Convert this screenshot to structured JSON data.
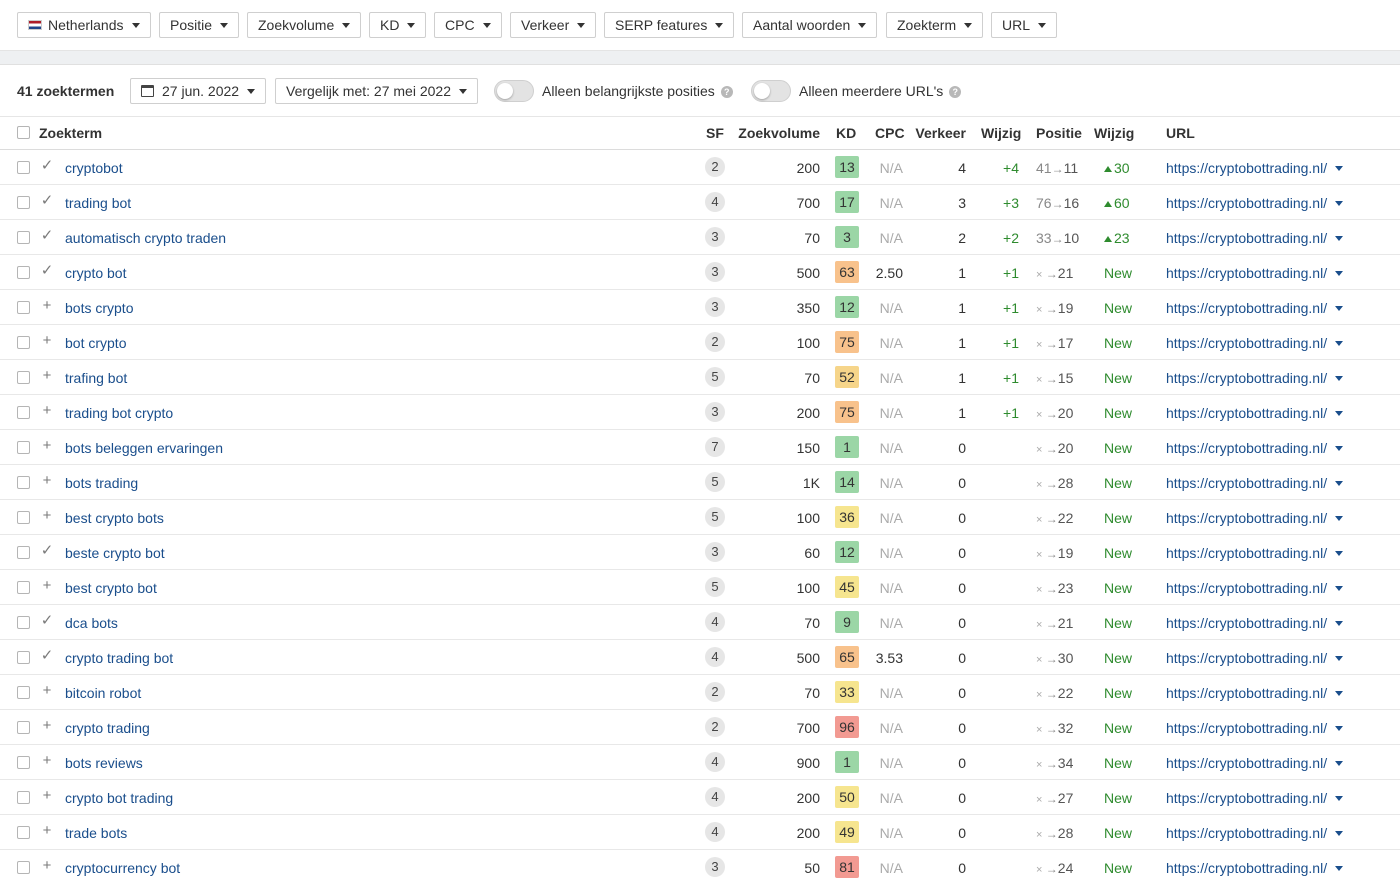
{
  "filters": [
    {
      "label": "Netherlands",
      "flag": true
    },
    {
      "label": "Positie"
    },
    {
      "label": "Zoekvolume"
    },
    {
      "label": "KD"
    },
    {
      "label": "CPC"
    },
    {
      "label": "Verkeer"
    },
    {
      "label": "SERP features"
    },
    {
      "label": "Aantal woorden"
    },
    {
      "label": "Zoekterm"
    },
    {
      "label": "URL"
    }
  ],
  "toolbar": {
    "count": "41 zoektermen",
    "date": "27 jun. 2022",
    "compare": "Vergelijk met: 27 mei 2022",
    "toggle1": "Alleen belangrijkste posities",
    "toggle2": "Alleen meerdere URL's",
    "help": "?"
  },
  "headers": {
    "keyword": "Zoekterm",
    "sf": "SF",
    "volume": "Zoekvolume",
    "kd": "KD",
    "cpc": "CPC",
    "traffic": "Verkeer",
    "change": "Wijzig",
    "position": "Positie",
    "change2": "Wijzig",
    "url": "URL"
  },
  "colors": {
    "kd_green": "#9bd6a6",
    "kd_lightgreen": "#c3e5b5",
    "kd_yellow": "#f6e58f",
    "kd_orange": "#f8c28c",
    "kd_red": "#f29a92",
    "link": "#1a4e8c",
    "positive": "#2e8b2e"
  },
  "rows": [
    {
      "mark": "check",
      "keyword": "cryptobot",
      "sf": "2",
      "volume": "200",
      "kd": "13",
      "kd_color": "#9bd6a6",
      "cpc": "N/A",
      "traffic": "4",
      "change": "+4",
      "pos_old": "41",
      "pos_new": "11",
      "change2": "30",
      "change2_up": true,
      "url": "https://cryptobottrading.nl/"
    },
    {
      "mark": "check",
      "keyword": "trading bot",
      "sf": "4",
      "volume": "700",
      "kd": "17",
      "kd_color": "#9bd6a6",
      "cpc": "N/A",
      "traffic": "3",
      "change": "+3",
      "pos_old": "76",
      "pos_new": "16",
      "change2": "60",
      "change2_up": true,
      "url": "https://cryptobottrading.nl/"
    },
    {
      "mark": "check",
      "keyword": "automatisch crypto traden",
      "sf": "3",
      "volume": "70",
      "kd": "3",
      "kd_color": "#9bd6a6",
      "cpc": "N/A",
      "traffic": "2",
      "change": "+2",
      "pos_old": "33",
      "pos_new": "10",
      "change2": "23",
      "change2_up": true,
      "url": "https://cryptobottrading.nl/"
    },
    {
      "mark": "check",
      "keyword": "crypto bot",
      "sf": "3",
      "volume": "500",
      "kd": "63",
      "kd_color": "#f8c28c",
      "cpc": "2.50",
      "traffic": "1",
      "change": "+1",
      "pos_old": "×",
      "pos_new": "21",
      "change2": "New",
      "change2_up": false,
      "url": "https://cryptobottrading.nl/"
    },
    {
      "mark": "plus",
      "keyword": "bots crypto",
      "sf": "3",
      "volume": "350",
      "kd": "12",
      "kd_color": "#9bd6a6",
      "cpc": "N/A",
      "traffic": "1",
      "change": "+1",
      "pos_old": "×",
      "pos_new": "19",
      "change2": "New",
      "change2_up": false,
      "url": "https://cryptobottrading.nl/"
    },
    {
      "mark": "plus",
      "keyword": "bot crypto",
      "sf": "2",
      "volume": "100",
      "kd": "75",
      "kd_color": "#f8c28c",
      "cpc": "N/A",
      "traffic": "1",
      "change": "+1",
      "pos_old": "×",
      "pos_new": "17",
      "change2": "New",
      "change2_up": false,
      "url": "https://cryptobottrading.nl/"
    },
    {
      "mark": "plus",
      "keyword": "trafing bot",
      "sf": "5",
      "volume": "70",
      "kd": "52",
      "kd_color": "#f6d58a",
      "cpc": "N/A",
      "traffic": "1",
      "change": "+1",
      "pos_old": "×",
      "pos_new": "15",
      "change2": "New",
      "change2_up": false,
      "url": "https://cryptobottrading.nl/"
    },
    {
      "mark": "plus",
      "keyword": "trading bot crypto",
      "sf": "3",
      "volume": "200",
      "kd": "75",
      "kd_color": "#f8c28c",
      "cpc": "N/A",
      "traffic": "1",
      "change": "+1",
      "pos_old": "×",
      "pos_new": "20",
      "change2": "New",
      "change2_up": false,
      "url": "https://cryptobottrading.nl/"
    },
    {
      "mark": "plus",
      "keyword": "bots beleggen ervaringen",
      "sf": "7",
      "volume": "150",
      "kd": "1",
      "kd_color": "#9bd6a6",
      "cpc": "N/A",
      "traffic": "0",
      "change": "",
      "pos_old": "×",
      "pos_new": "20",
      "change2": "New",
      "change2_up": false,
      "url": "https://cryptobottrading.nl/"
    },
    {
      "mark": "plus",
      "keyword": "bots trading",
      "sf": "5",
      "volume": "1K",
      "kd": "14",
      "kd_color": "#9bd6a6",
      "cpc": "N/A",
      "traffic": "0",
      "change": "",
      "pos_old": "×",
      "pos_new": "28",
      "change2": "New",
      "change2_up": false,
      "url": "https://cryptobottrading.nl/"
    },
    {
      "mark": "plus",
      "keyword": "best crypto bots",
      "sf": "5",
      "volume": "100",
      "kd": "36",
      "kd_color": "#f6e58f",
      "cpc": "N/A",
      "traffic": "0",
      "change": "",
      "pos_old": "×",
      "pos_new": "22",
      "change2": "New",
      "change2_up": false,
      "url": "https://cryptobottrading.nl/"
    },
    {
      "mark": "check",
      "keyword": "beste crypto bot",
      "sf": "3",
      "volume": "60",
      "kd": "12",
      "kd_color": "#9bd6a6",
      "cpc": "N/A",
      "traffic": "0",
      "change": "",
      "pos_old": "×",
      "pos_new": "19",
      "change2": "New",
      "change2_up": false,
      "url": "https://cryptobottrading.nl/"
    },
    {
      "mark": "plus",
      "keyword": "best crypto bot",
      "sf": "5",
      "volume": "100",
      "kd": "45",
      "kd_color": "#f6e58f",
      "cpc": "N/A",
      "traffic": "0",
      "change": "",
      "pos_old": "×",
      "pos_new": "23",
      "change2": "New",
      "change2_up": false,
      "url": "https://cryptobottrading.nl/"
    },
    {
      "mark": "check",
      "keyword": "dca bots",
      "sf": "4",
      "volume": "70",
      "kd": "9",
      "kd_color": "#9bd6a6",
      "cpc": "N/A",
      "traffic": "0",
      "change": "",
      "pos_old": "×",
      "pos_new": "21",
      "change2": "New",
      "change2_up": false,
      "url": "https://cryptobottrading.nl/"
    },
    {
      "mark": "check",
      "keyword": "crypto trading bot",
      "sf": "4",
      "volume": "500",
      "kd": "65",
      "kd_color": "#f8c28c",
      "cpc": "3.53",
      "traffic": "0",
      "change": "",
      "pos_old": "×",
      "pos_new": "30",
      "change2": "New",
      "change2_up": false,
      "url": "https://cryptobottrading.nl/"
    },
    {
      "mark": "plus",
      "keyword": "bitcoin robot",
      "sf": "2",
      "volume": "70",
      "kd": "33",
      "kd_color": "#f6e58f",
      "cpc": "N/A",
      "traffic": "0",
      "change": "",
      "pos_old": "×",
      "pos_new": "22",
      "change2": "New",
      "change2_up": false,
      "url": "https://cryptobottrading.nl/"
    },
    {
      "mark": "plus",
      "keyword": "crypto trading",
      "sf": "2",
      "volume": "700",
      "kd": "96",
      "kd_color": "#f29a92",
      "cpc": "N/A",
      "traffic": "0",
      "change": "",
      "pos_old": "×",
      "pos_new": "32",
      "change2": "New",
      "change2_up": false,
      "url": "https://cryptobottrading.nl/"
    },
    {
      "mark": "plus",
      "keyword": "bots reviews",
      "sf": "4",
      "volume": "900",
      "kd": "1",
      "kd_color": "#9bd6a6",
      "cpc": "N/A",
      "traffic": "0",
      "change": "",
      "pos_old": "×",
      "pos_new": "34",
      "change2": "New",
      "change2_up": false,
      "url": "https://cryptobottrading.nl/"
    },
    {
      "mark": "plus",
      "keyword": "crypto bot trading",
      "sf": "4",
      "volume": "200",
      "kd": "50",
      "kd_color": "#f6e58f",
      "cpc": "N/A",
      "traffic": "0",
      "change": "",
      "pos_old": "×",
      "pos_new": "27",
      "change2": "New",
      "change2_up": false,
      "url": "https://cryptobottrading.nl/"
    },
    {
      "mark": "plus",
      "keyword": "trade bots",
      "sf": "4",
      "volume": "200",
      "kd": "49",
      "kd_color": "#f6e58f",
      "cpc": "N/A",
      "traffic": "0",
      "change": "",
      "pos_old": "×",
      "pos_new": "28",
      "change2": "New",
      "change2_up": false,
      "url": "https://cryptobottrading.nl/"
    },
    {
      "mark": "plus",
      "keyword": "cryptocurrency bot",
      "sf": "3",
      "volume": "50",
      "kd": "81",
      "kd_color": "#f29a92",
      "cpc": "N/A",
      "traffic": "0",
      "change": "",
      "pos_old": "×",
      "pos_new": "24",
      "change2": "New",
      "change2_up": false,
      "url": "https://cryptobottrading.nl/"
    }
  ]
}
